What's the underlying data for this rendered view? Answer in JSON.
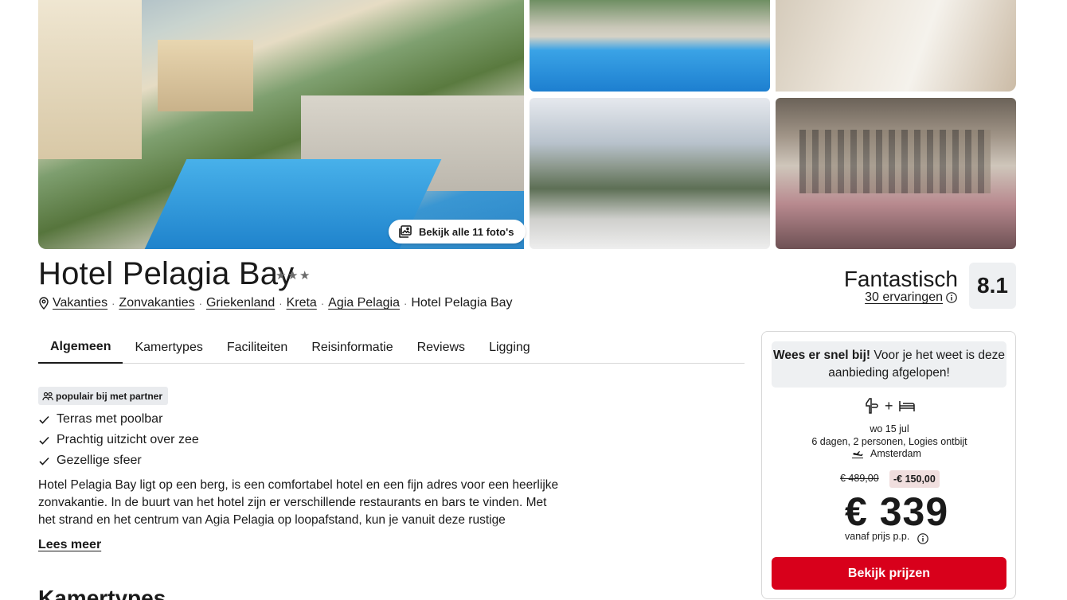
{
  "gallery": {
    "all_photos_label": "Bekijk alle 11 foto's",
    "images": [
      "hotel-pool-exterior",
      "pool-loungers",
      "bedroom",
      "sea-view-terrace",
      "hotel-bar"
    ]
  },
  "hotel": {
    "name": "Hotel Pelagia Bay",
    "stars": 3
  },
  "breadcrumb": {
    "items": [
      "Vakanties",
      "Zonvakanties",
      "Griekenland",
      "Kreta",
      "Agia Pelagia"
    ],
    "current": "Hotel Pelagia Bay"
  },
  "rating": {
    "word": "Fantastisch",
    "count": "30 ervaringen",
    "score": "8.1"
  },
  "tabs": [
    "Algemeen",
    "Kamertypes",
    "Faciliteiten",
    "Reisinformatie",
    "Reviews",
    "Ligging"
  ],
  "partner_badge": "populair bij met partner",
  "features": [
    "Terras met poolbar",
    "Prachtig uitzicht over zee",
    "Gezellige sfeer"
  ],
  "description": "Hotel Pelagia Bay ligt op een berg, is een comfortabel hotel en een fijn adres voor een heerlijke zonvakantie. In de buurt van het hotel zijn er verschillende restaurants en bars te vinden. Met het strand en het centrum van Agia Pelagia op loopafstand, kun je vanuit deze rustige omgeving heel eenvoudig het levendige dorp ontdekken.",
  "read_more": "Lees meer",
  "section_title": "Kamertypes",
  "booking": {
    "alert_bold": "Wees er snel bij!",
    "alert_text": "Voor je het weet is deze aanbieding afgelopen!",
    "date_line1": "wo 15 jul",
    "date_line2": "6 dagen, 2 personen, Logies ontbijt",
    "origin": "Amsterdam",
    "old_price": "€ 489,00",
    "discount": "-€ 150,00",
    "price": "€ 339",
    "vanaf": "vanaf prijs p.p.",
    "cta": "Bekijk prijzen",
    "cta_color": "#d8001b"
  }
}
